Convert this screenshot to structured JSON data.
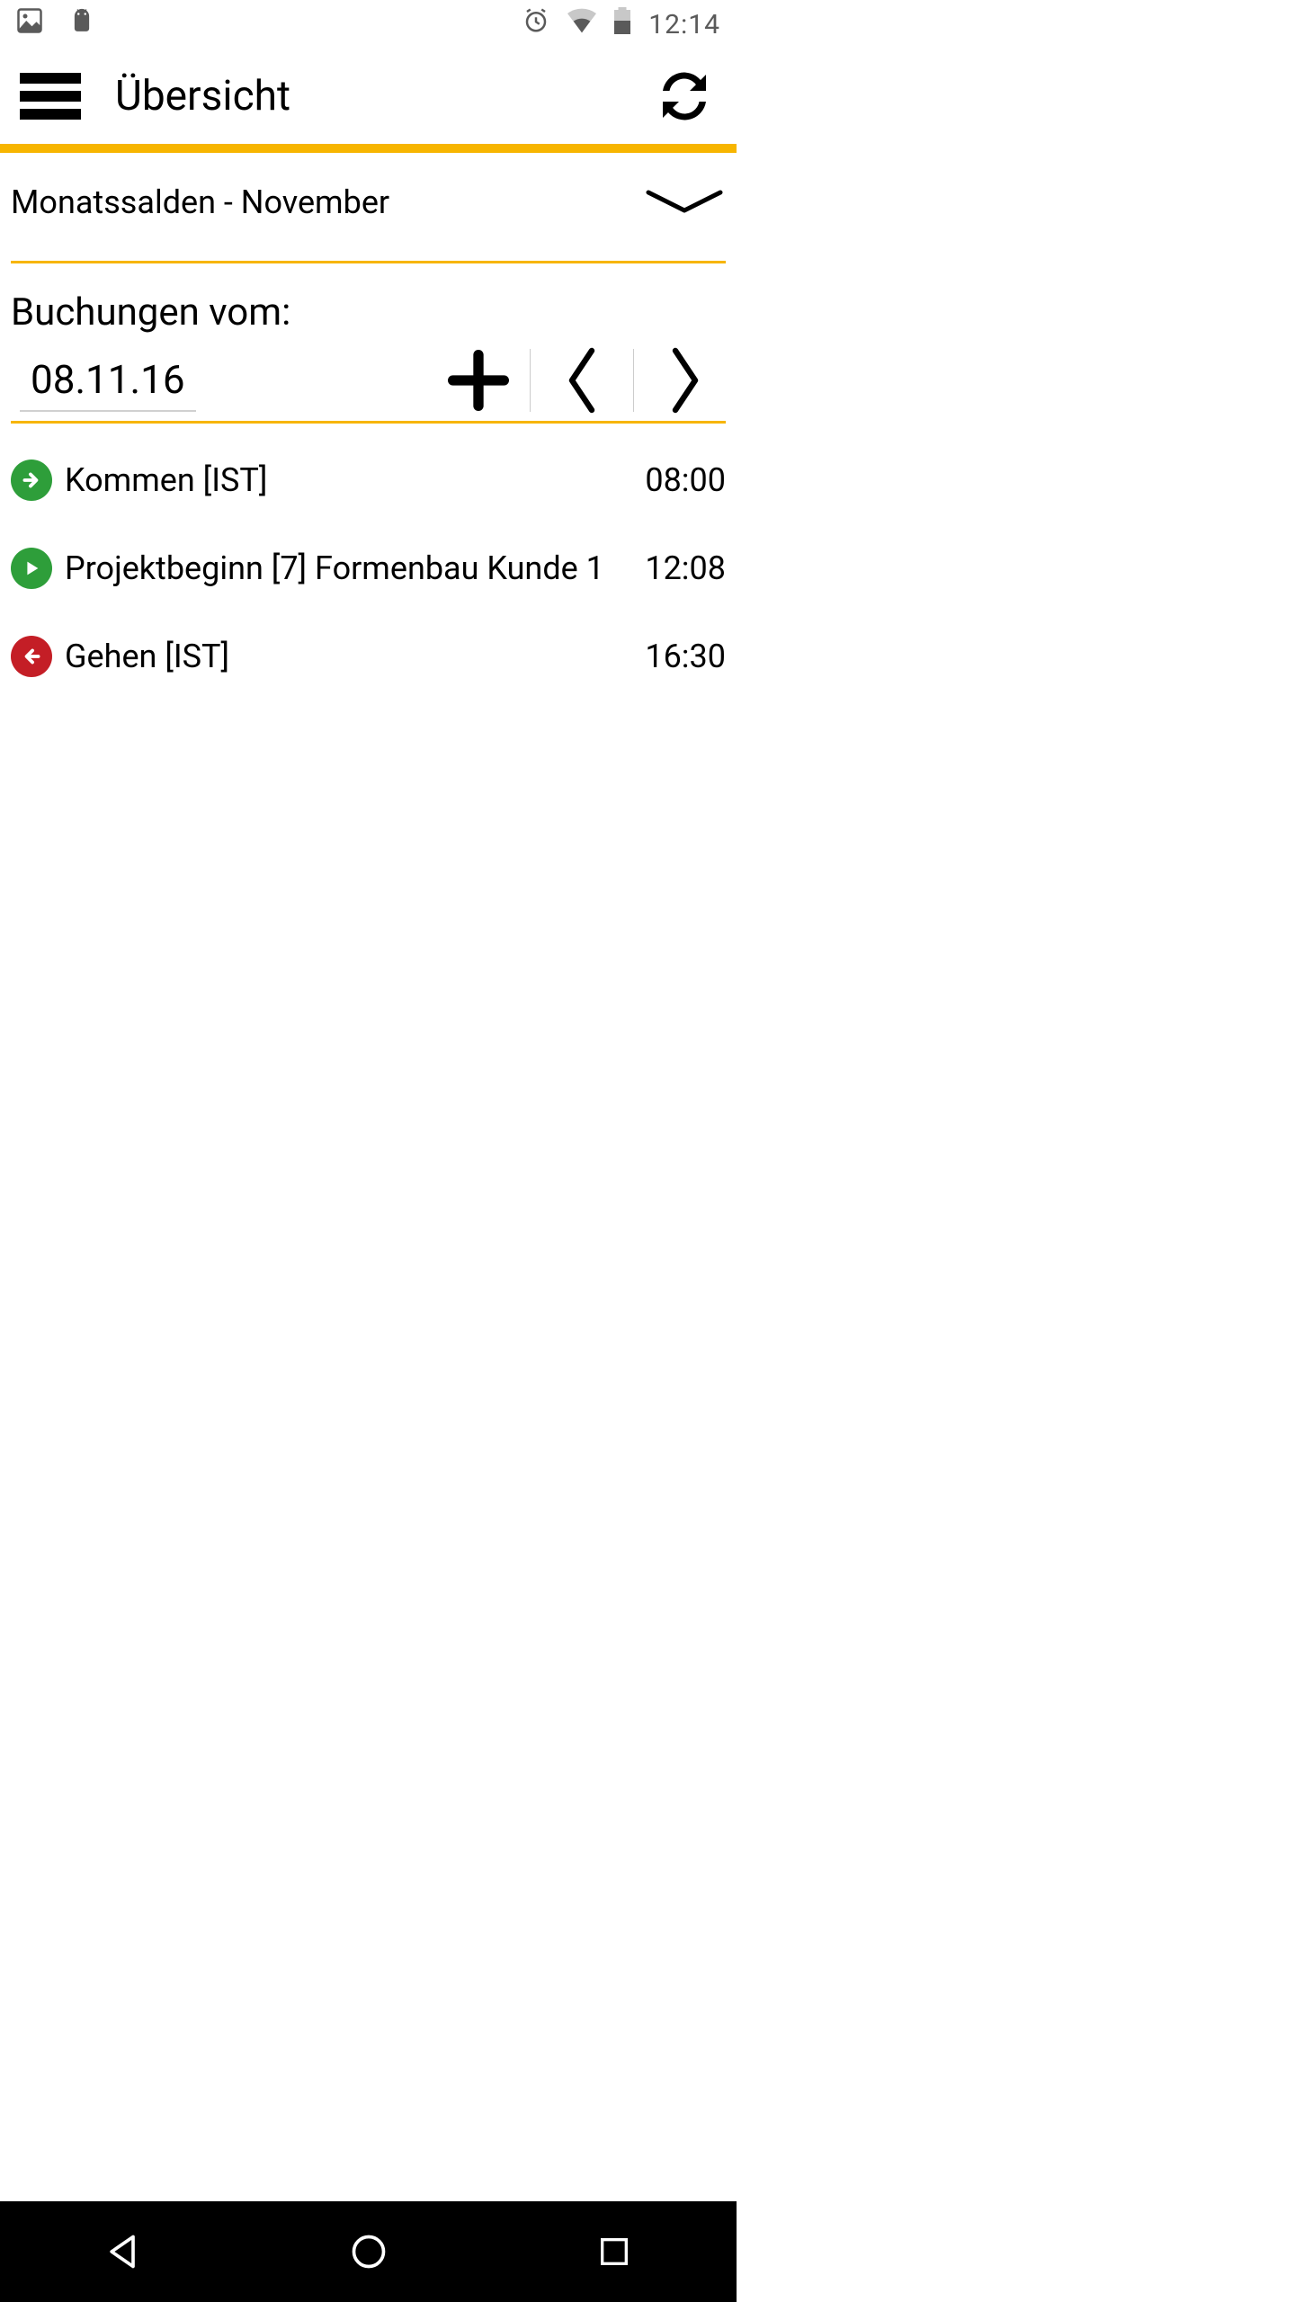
{
  "status": {
    "time": "12:14"
  },
  "header": {
    "title": "Übersicht"
  },
  "salden": {
    "title": "Monatssalden - November"
  },
  "bookings": {
    "label": "Buchungen vom:",
    "date": "08.11.16"
  },
  "entries": [
    {
      "icon": "arrow-right",
      "color": "green",
      "label": "Kommen [IST]",
      "time": "08:00"
    },
    {
      "icon": "play",
      "color": "green",
      "label": "Projektbeginn [7] Formenbau Kunde 1",
      "time": "12:08"
    },
    {
      "icon": "arrow-left",
      "color": "red",
      "label": "Gehen [IST]",
      "time": "16:30"
    }
  ],
  "colors": {
    "accent": "#f7b500",
    "green": "#2e9e3a",
    "red": "#c41e26"
  }
}
